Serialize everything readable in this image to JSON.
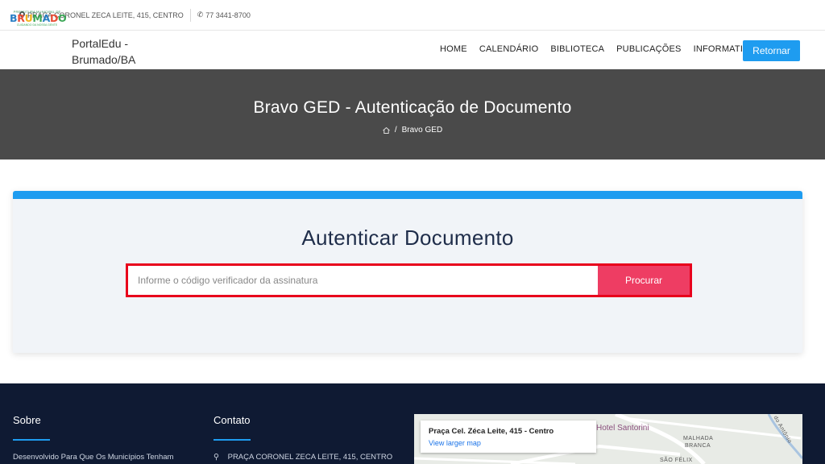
{
  "topbar": {
    "address": "PRAÇA CORONEL ZECA LEITE, 415, CENTRO",
    "phone": "77 3441-8700"
  },
  "logo": {
    "top_text": "PREFEITURA MUNICIPAL DE",
    "word": "BRUMADO",
    "sub_text": "CUIDANDO DA NOSSA GENTE"
  },
  "header": {
    "brand_line1": "PortalEdu -",
    "brand_line2": "Brumado/BA",
    "nav": [
      "HOME",
      "CALENDÁRIO",
      "BIBLIOTECA",
      "PUBLICAÇÕES",
      "INFORMATIVOS"
    ],
    "retornar_label": "Retornar"
  },
  "banner": {
    "title": "Bravo GED - Autenticação de Documento",
    "breadcrumb_current": "Bravo GED"
  },
  "main": {
    "heading": "Autenticar Documento",
    "search_placeholder": "Informe o código verificador da assinatura",
    "search_value": "",
    "search_button": "Procurar"
  },
  "footer": {
    "about_title": "Sobre",
    "about_text": "Desenvolvido Para Que Os Municípios Tenham",
    "contact_title": "Contato",
    "contact_text": "PRAÇA CORONEL ZECA LEITE, 415, CENTRO",
    "map": {
      "place": "Praça Cel. Zéca Leite, 415 - Centro",
      "link": "View larger map",
      "label_hotel": "Hotel Santorini",
      "label_malhada": "MALHADA",
      "label_branca": "BRANCA",
      "label_sao_felix": "SÃO FÉLIX",
      "label_road": "do Antônio"
    }
  },
  "colors": {
    "accent": "#1e9cf0",
    "button_red": "#ee3d63",
    "highlight_border": "#e8001c",
    "banner_bg": "#4a4a4a",
    "footer_bg": "#0f1a33"
  }
}
